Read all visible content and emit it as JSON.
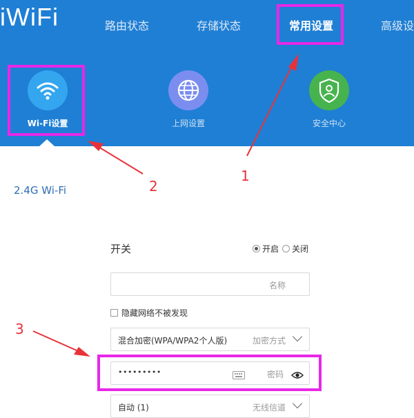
{
  "header": {
    "logo": "iWiFi",
    "nav": [
      "路由状态",
      "存储状态",
      "常用设置",
      "高级设"
    ],
    "active_nav": 2
  },
  "subnav": [
    {
      "label": "Wi-Fi设置",
      "icon": "wifi-icon",
      "active": true
    },
    {
      "label": "上网设置",
      "icon": "globe-icon",
      "active": false
    },
    {
      "label": "安全中心",
      "icon": "shield-user-icon",
      "active": false
    }
  ],
  "section_title": "2.4G Wi-Fi",
  "form": {
    "switch_label": "开关",
    "switch_on": "开启",
    "switch_off": "关闭",
    "name_placeholder": "名称",
    "hide_network_label": "隐藏网络不被发现",
    "encryption_value": "混合加密(WPA/WPA2个人版)",
    "encryption_label": "加密方式",
    "password_value": "•••••••••",
    "password_label": "密码",
    "channel_value": "自动 (1)",
    "channel_label": "无线信道"
  },
  "annotations": [
    "1",
    "2",
    "3"
  ],
  "colors": {
    "header_bg": "#1f7fd4",
    "wifi_circle": "#34a6f0",
    "globe_circle": "#7b8ef0",
    "shield_circle": "#47b34e",
    "annotation_box": "#e827e8",
    "annotation_arrow": "#e8323a"
  }
}
